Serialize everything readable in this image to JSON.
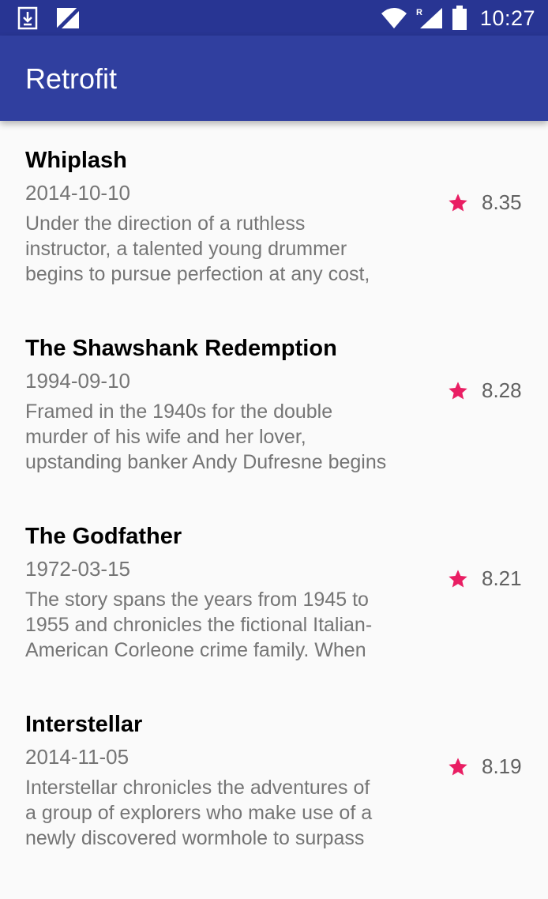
{
  "status_bar": {
    "time": "10:27",
    "left_icons": [
      "download-notification-icon",
      "no-sim-icon"
    ],
    "right_icons": [
      "wifi-icon",
      "signal-roaming-icon",
      "battery-icon"
    ],
    "roaming_label": "R"
  },
  "app_bar": {
    "title": "Retrofit",
    "color": "#303f9f"
  },
  "colors": {
    "status_bar": "#283593",
    "accent": "#e91e63",
    "background": "#fafafa"
  },
  "movies": [
    {
      "title": "Whiplash",
      "date": "2014-10-10",
      "description": [
        "Under the direction of a ruthless",
        "instructor, a talented young drummer",
        "begins to pursue perfection at any cost,"
      ],
      "rating": "8.35"
    },
    {
      "title": "The Shawshank Redemption",
      "date": "1994-09-10",
      "description": [
        "Framed in the 1940s for the double",
        "murder of his wife and her lover,",
        "upstanding banker Andy Dufresne begins"
      ],
      "rating": "8.28"
    },
    {
      "title": "The Godfather",
      "date": "1972-03-15",
      "description": [
        "The story spans the years from 1945 to",
        "1955 and chronicles the fictional Italian-",
        "American Corleone crime family. When"
      ],
      "rating": "8.21"
    },
    {
      "title": "Interstellar",
      "date": "2014-11-05",
      "description": [
        "Interstellar chronicles the adventures of",
        "a group of explorers who make use of a",
        "newly discovered wormhole to surpass"
      ],
      "rating": "8.19"
    }
  ]
}
